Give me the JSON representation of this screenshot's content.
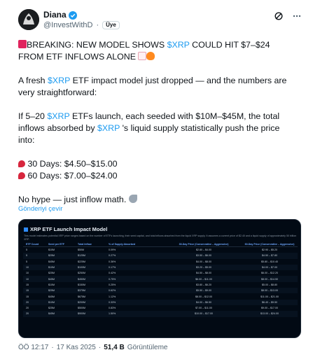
{
  "author": {
    "display_name": "Diana",
    "handle": "@InvestWithD",
    "separator": "·",
    "follow_label": "Üye"
  },
  "tweet": {
    "p1_text": "BREAKING: NEW MODEL SHOWS ",
    "p1_tag": "$XRP",
    "p1_text2": " COULD HIT $7–$24 FROM ETF INFLOWS ALONE ",
    "p2_text": "A fresh ",
    "p2_tag": "$XRP",
    "p2_text2": " ETF impact model just dropped — and the numbers are very straightforward:",
    "p3_text": "If 5–20 ",
    "p3_tag": "$XRP",
    "p3_text2": " ETFs launch, each seeded with $10M–$45M, the total inflows absorbed by ",
    "p3_tag2": "$XRP",
    "p3_text3": " 's liquid supply statistically push the price into:",
    "line_30": " 30 Days: $4.50–$15.00",
    "line_60": " 60 Days: $7.00–$24.00",
    "closing": "No hype — just inflow math. ",
    "translate": "Gönderiyi çevir"
  },
  "media": {
    "title": "XRP ETF Launch Impact Model",
    "subtitle": "This model estimates potential XRP price ranges based on the number of ETFs launching, their seed capital, and total inflows absorbed from the liquid XRP supply. It assumes a current price of $2.40 and a liquid supply of approximately 50 billion XRP.",
    "columns": [
      "ETF Count",
      "Seed per ETF",
      "Total Inflow",
      "% of Supply Absorbed",
      "30-Day Price (Conservative – Aggressive)",
      "60-Day Price (Conservative – Aggressive)"
    ],
    "rows": [
      [
        "5",
        "$10M",
        "$50M",
        "0.09%",
        "$2.80 – $4.00",
        "$2.90 – $5.20"
      ],
      [
        "5",
        "$25M",
        "$125M",
        "0.27%",
        "$3.50 – $6.00",
        "$4.50 – $7.80"
      ],
      [
        "5",
        "$45M",
        "$225M",
        "0.36%",
        "$4.00 – $8.00",
        "$5.80 – $10.40"
      ],
      [
        "10",
        "$10M",
        "$100M",
        "0.17%",
        "$3.20 – $5.00",
        "$4.00 – $7.00"
      ],
      [
        "10",
        "$25M",
        "$250M",
        "0.42%",
        "$4.50 – $8.00",
        "$6.00 – $12.20"
      ],
      [
        "10",
        "$45M",
        "$450M",
        "0.75%",
        "$6.00 – $11.00",
        "$8.00 – $14.50"
      ],
      [
        "15",
        "$10M",
        "$150M",
        "0.25%",
        "$3.80 – $6.20",
        "$5.00 – $8.80"
      ],
      [
        "15",
        "$25M",
        "$375M",
        "0.62%",
        "$5.50 – $9.00",
        "$8.00 – $13.00"
      ],
      [
        "15",
        "$45M",
        "$675M",
        "1.12%",
        "$8.00 – $12.00",
        "$11.00 – $21.00"
      ],
      [
        "20",
        "$10M",
        "$200M",
        "0.33%",
        "$4.00 – $6.50",
        "$6.40 – $9.50"
      ],
      [
        "20",
        "$25M",
        "$500M",
        "0.83%",
        "$7.00 – $11.00",
        "$9.00 – $17.00"
      ],
      [
        "20",
        "$45M",
        "$900M",
        "1.50%",
        "$10.00 – $17.00",
        "$13.00 – $24.00"
      ]
    ]
  },
  "footer": {
    "time": "ÖÖ 12:17",
    "date": "17 Kas 2025",
    "views": "51,4 B",
    "views_label": "Görüntüleme",
    "separator": "·"
  }
}
